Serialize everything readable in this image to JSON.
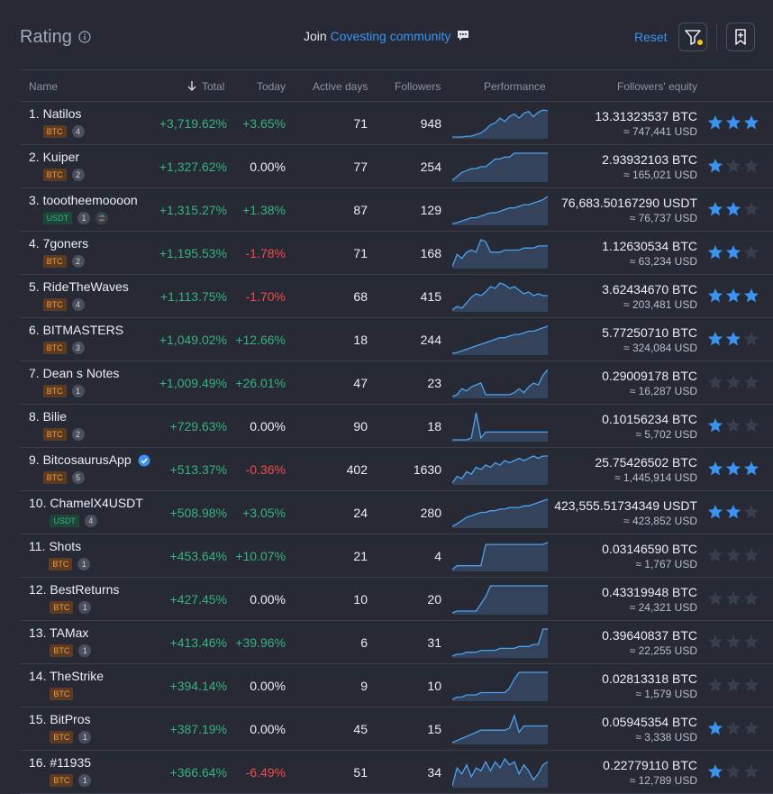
{
  "header": {
    "title": "Rating",
    "join_prefix": "Join",
    "join_link": "Covesting community",
    "reset_label": "Reset"
  },
  "columns": {
    "name": "Name",
    "total": "Total",
    "today": "Today",
    "active": "Active days",
    "followers": "Followers",
    "performance": "Performance",
    "equity": "Followers' equity"
  },
  "colors": {
    "positive": "#36b37e",
    "negative": "#ef4b4b",
    "link": "#3b93f1",
    "star_on": "#3b93f1",
    "star_off": "#3a3d4a",
    "filter_dot": "#f5c518"
  },
  "rows": [
    {
      "rank": "1.",
      "name": "Natilos",
      "cur": "BTC",
      "count": "4",
      "total": "+3,719.62%",
      "today": "+3.65%",
      "active": "71",
      "followers": "948",
      "eq": "13.31323537 BTC",
      "usd": "≈ 747,441 USD",
      "stars": 3,
      "perf": [
        5,
        5,
        5,
        6,
        6,
        8,
        10,
        14,
        20,
        22,
        28,
        24,
        30,
        33,
        28,
        34,
        36,
        30,
        35,
        38,
        37
      ],
      "verified": false,
      "bell": false
    },
    {
      "rank": "2.",
      "name": "Kuiper",
      "cur": "BTC",
      "count": "2",
      "total": "+1,327.62%",
      "today": "0.00%",
      "active": "77",
      "followers": "254",
      "eq": "2.93932103 BTC",
      "usd": "≈ 165,021 USD",
      "stars": 1,
      "perf": [
        8,
        12,
        16,
        18,
        20,
        20,
        22,
        22,
        26,
        30,
        30,
        32,
        32,
        36,
        36,
        36,
        36,
        36,
        36,
        36,
        36
      ],
      "verified": false,
      "bell": false
    },
    {
      "rank": "3.",
      "name": "toootheemoooon",
      "cur": "USDT",
      "count": "1",
      "total": "+1,315.27%",
      "today": "+1.38%",
      "active": "87",
      "followers": "129",
      "eq": "76,683.50167290 USDT",
      "usd": "≈ 76,737 USD",
      "stars": 2,
      "perf": [
        5,
        6,
        8,
        10,
        12,
        12,
        14,
        16,
        18,
        18,
        20,
        22,
        24,
        24,
        26,
        28,
        28,
        30,
        32,
        34,
        38
      ],
      "verified": false,
      "bell": true
    },
    {
      "rank": "4.",
      "name": "7goners",
      "cur": "BTC",
      "count": "2",
      "total": "+1,195.53%",
      "today": "-1.78%",
      "active": "71",
      "followers": "168",
      "eq": "1.12630534 BTC",
      "usd": "≈ 63,234 USD",
      "stars": 2,
      "perf": [
        10,
        22,
        18,
        24,
        26,
        24,
        36,
        34,
        24,
        24,
        24,
        26,
        26,
        26,
        26,
        28,
        28,
        28,
        30,
        30,
        30
      ],
      "verified": false,
      "bell": false
    },
    {
      "rank": "5.",
      "name": "RideTheWaves",
      "cur": "BTC",
      "count": "4",
      "total": "+1,113.75%",
      "today": "-1.70%",
      "active": "68",
      "followers": "415",
      "eq": "3.62434670 BTC",
      "usd": "≈ 203,481 USD",
      "stars": 3,
      "perf": [
        6,
        10,
        8,
        14,
        20,
        24,
        22,
        26,
        32,
        30,
        36,
        34,
        30,
        32,
        28,
        24,
        26,
        22,
        24,
        22,
        22
      ],
      "verified": false,
      "bell": false
    },
    {
      "rank": "6.",
      "name": "BITMASTERS",
      "cur": "BTC",
      "count": "3",
      "total": "+1,049.02%",
      "today": "+12.66%",
      "active": "18",
      "followers": "244",
      "eq": "5.77250710 BTC",
      "usd": "≈ 324,084 USD",
      "stars": 2,
      "perf": [
        5,
        6,
        8,
        10,
        12,
        14,
        16,
        18,
        20,
        22,
        24,
        24,
        26,
        28,
        28,
        30,
        32,
        32,
        34,
        36,
        38
      ],
      "verified": false,
      "bell": false
    },
    {
      "rank": "7.",
      "name": "Dean s Notes",
      "cur": "BTC",
      "count": "1",
      "total": "+1,009.49%",
      "today": "+26.01%",
      "active": "47",
      "followers": "23",
      "eq": "0.29009178 BTC",
      "usd": "≈ 16,287 USD",
      "stars": 0,
      "perf": [
        6,
        8,
        14,
        12,
        16,
        18,
        20,
        8,
        8,
        8,
        8,
        8,
        8,
        10,
        14,
        10,
        16,
        20,
        18,
        28,
        34
      ],
      "verified": false,
      "bell": false
    },
    {
      "rank": "8.",
      "name": "Bilie",
      "cur": "BTC",
      "count": "2",
      "total": "+729.63%",
      "today": "0.00%",
      "active": "90",
      "followers": "18",
      "eq": "0.10156234 BTC",
      "usd": "≈ 5,702 USD",
      "stars": 1,
      "perf": [
        6,
        6,
        6,
        6,
        8,
        34,
        8,
        14,
        14,
        14,
        14,
        14,
        14,
        14,
        14,
        14,
        14,
        14,
        14,
        14,
        14
      ],
      "verified": false,
      "bell": false
    },
    {
      "rank": "9.",
      "name": "BitcosaurusApp",
      "cur": "BTC",
      "count": "5",
      "total": "+513.37%",
      "today": "-0.36%",
      "active": "402",
      "followers": "1630",
      "eq": "25.75426502 BTC",
      "usd": "≈ 1,445,914 USD",
      "stars": 3,
      "perf": [
        8,
        14,
        12,
        18,
        16,
        22,
        20,
        24,
        22,
        26,
        24,
        28,
        26,
        28,
        30,
        28,
        30,
        32,
        30,
        32,
        32
      ],
      "verified": true,
      "bell": false
    },
    {
      "rank": "10.",
      "name": "ChamelX4USDT",
      "cur": "USDT",
      "count": "4",
      "total": "+508.98%",
      "today": "+3.05%",
      "active": "24",
      "followers": "280",
      "eq": "423,555.51734349 USDT",
      "usd": "≈ 423,852 USD",
      "stars": 2,
      "perf": [
        5,
        8,
        12,
        16,
        18,
        20,
        22,
        22,
        24,
        24,
        26,
        26,
        28,
        28,
        28,
        30,
        30,
        32,
        34,
        36,
        38
      ],
      "verified": false,
      "bell": false
    },
    {
      "rank": "11.",
      "name": "Shots",
      "cur": "BTC",
      "count": "1",
      "total": "+453.64%",
      "today": "+10.07%",
      "active": "21",
      "followers": "4",
      "eq": "0.03146590 BTC",
      "usd": "≈ 1,767 USD",
      "stars": 0,
      "perf": [
        4,
        8,
        8,
        8,
        8,
        8,
        8,
        30,
        30,
        30,
        30,
        30,
        30,
        30,
        30,
        30,
        30,
        30,
        30,
        30,
        32
      ],
      "verified": false,
      "bell": false
    },
    {
      "rank": "12.",
      "name": "BestReturns",
      "cur": "BTC",
      "count": "1",
      "total": "+427.45%",
      "today": "0.00%",
      "active": "10",
      "followers": "20",
      "eq": "0.43319948 BTC",
      "usd": "≈ 24,321 USD",
      "stars": 0,
      "perf": [
        4,
        6,
        6,
        6,
        6,
        6,
        14,
        22,
        34,
        34,
        34,
        34,
        34,
        34,
        34,
        34,
        34,
        34,
        34,
        34,
        34
      ],
      "verified": false,
      "bell": false
    },
    {
      "rank": "13.",
      "name": "TAMax",
      "cur": "BTC",
      "count": "1",
      "total": "+413.46%",
      "today": "+39.96%",
      "active": "6",
      "followers": "31",
      "eq": "0.39640837 BTC",
      "usd": "≈ 22,255 USD",
      "stars": 0,
      "perf": [
        6,
        8,
        8,
        10,
        10,
        10,
        12,
        12,
        12,
        12,
        14,
        14,
        14,
        14,
        16,
        16,
        16,
        18,
        18,
        34,
        34
      ],
      "verified": false,
      "bell": false
    },
    {
      "rank": "14.",
      "name": "TheStrike",
      "cur": "BTC",
      "count": "",
      "total": "+394.14%",
      "today": "0.00%",
      "active": "9",
      "followers": "10",
      "eq": "0.02813318 BTC",
      "usd": "≈ 1,579 USD",
      "stars": 0,
      "perf": [
        4,
        6,
        6,
        8,
        8,
        8,
        10,
        10,
        10,
        10,
        10,
        10,
        14,
        22,
        28,
        28,
        28,
        28,
        28,
        28,
        28
      ],
      "verified": false,
      "bell": false
    },
    {
      "rank": "15.",
      "name": "BitPros",
      "cur": "BTC",
      "count": "1",
      "total": "+387.19%",
      "today": "0.00%",
      "active": "45",
      "followers": "15",
      "eq": "0.05945354 BTC",
      "usd": "≈ 3,338 USD",
      "stars": 1,
      "perf": [
        4,
        6,
        8,
        10,
        12,
        14,
        16,
        16,
        16,
        16,
        16,
        16,
        18,
        30,
        14,
        20,
        20,
        20,
        20,
        20,
        20
      ],
      "verified": false,
      "bell": false
    },
    {
      "rank": "16.",
      "name": "#11935",
      "cur": "BTC",
      "count": "1",
      "total": "+366.64%",
      "today": "-6.49%",
      "active": "51",
      "followers": "34",
      "eq": "0.22779110 BTC",
      "usd": "≈ 12,789 USD",
      "stars": 1,
      "perf": [
        14,
        26,
        22,
        28,
        20,
        26,
        24,
        30,
        24,
        30,
        26,
        32,
        28,
        30,
        22,
        28,
        24,
        18,
        22,
        28,
        30
      ],
      "verified": false,
      "bell": false
    }
  ]
}
